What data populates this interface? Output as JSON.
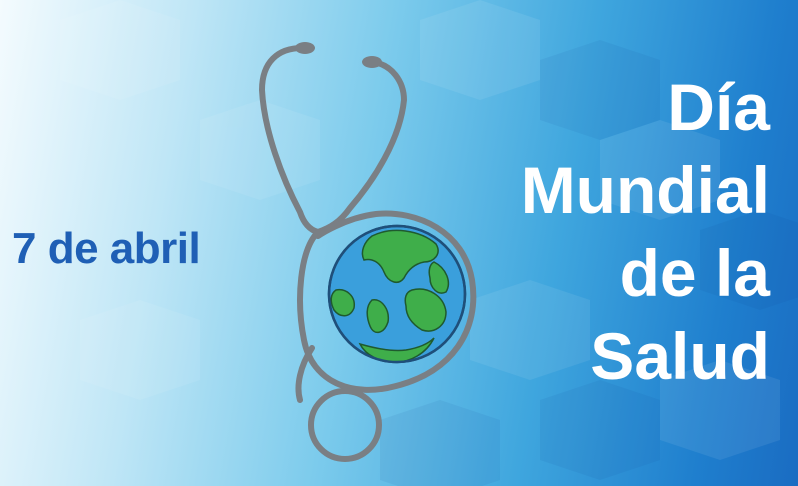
{
  "banner": {
    "date": "7 de abril",
    "title_lines": [
      "Día",
      "Mundial",
      "de la",
      "Salud"
    ]
  },
  "colors": {
    "date_text": "#1f5fb5",
    "title_text": "#ffffff",
    "stethoscope": "#7a7f84",
    "globe_ocean": "#3a9fdc",
    "globe_land": "#3fae4a"
  },
  "icons": [
    "stethoscope-icon",
    "globe-icon"
  ]
}
